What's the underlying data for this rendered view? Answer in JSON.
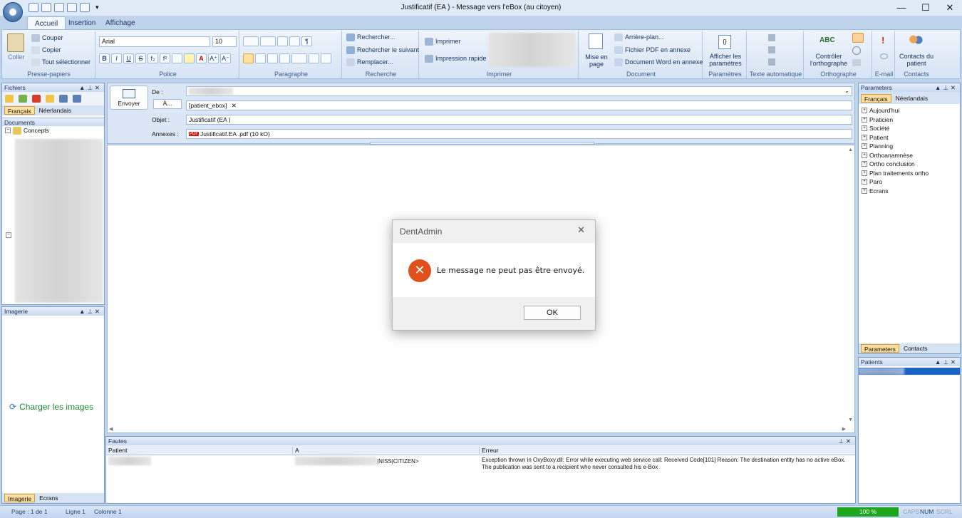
{
  "window": {
    "title": "Justificatif (EA ) - Message vers l'eBox (au citoyen)",
    "min": "—",
    "max": "☐",
    "close": "✕"
  },
  "tabs": [
    "Accueil",
    "Insertion",
    "Affichage"
  ],
  "ribbon": {
    "clipboard": {
      "paste": "Coller",
      "cut": "Couper",
      "copy": "Copier",
      "select_all": "Tout sélectionner",
      "label": "Presse-papiers"
    },
    "font": {
      "family": "Arial",
      "size": "10",
      "label": "Police",
      "bold": "B",
      "italic": "I",
      "underline": "U",
      "strike": "S",
      "sub": "f₂",
      "sup": "f²",
      "grow": "A⁺",
      "shrink": "A⁻",
      "color": "A"
    },
    "paragraph": {
      "label": "Paragraphe",
      "pilcrow": "¶"
    },
    "search": {
      "find": "Rechercher...",
      "find_next": "Rechercher le suivant",
      "replace": "Remplacer...",
      "label": "Recherche"
    },
    "print": {
      "print": "Imprimer",
      "quick_print": "Impression rapide",
      "label": "Imprimer"
    },
    "document": {
      "layout": "Mise en page",
      "background": "Arrière-plan...",
      "pdf": "Fichier PDF en annexe",
      "word": "Document Word en annexe",
      "label": "Document"
    },
    "params": {
      "show": "Afficher les paramètres",
      "label": "Paramètres"
    },
    "autotext": {
      "label": "Texte automatique"
    },
    "spelling": {
      "check": "Contrôler l'orthographe",
      "label": "Orthographe",
      "abc": "ABC"
    },
    "email": {
      "label": "E-mail",
      "excl": "!"
    },
    "contacts": {
      "button": "Contacts du patient",
      "label": "Contacts"
    }
  },
  "left": {
    "files_title": "Fichiers",
    "lang_fr": "Français",
    "lang_nl": "Néerlandais",
    "docs_header": "Documents",
    "root": "Concepts",
    "imagery_title": "Imagerie",
    "load_images": "Charger les images",
    "bottom_tabs": [
      "Imagerie",
      "Ecrans"
    ]
  },
  "compose": {
    "send": "Envoyer",
    "from_label": "De :",
    "to_button": "À...",
    "to_value": "[patient_ebox]",
    "to_remove": "✕",
    "subject_label": "Objet :",
    "subject_value": "Justificatif (EA )",
    "attach_label": "Annexes :",
    "attach_value": "Justificatif.EA .pdf (10 kO)",
    "pdf_badge": "PDF"
  },
  "faults": {
    "title": "Fautes",
    "columns": [
      "Patient",
      "A",
      "Erreur"
    ],
    "rows": [
      {
        "patient": "",
        "to": "|NISS|CITIZEN>",
        "error": "Exception thrown in OxyBoxy.dll: Error while executing web service call: Received Code[101] Reason:  The destination entity has no active eBox. The publication was sent to a recipient who never consulted his e-Box"
      }
    ]
  },
  "right": {
    "params_title": "Parameters",
    "lang_fr": "Français",
    "lang_nl": "Néerlandais",
    "items": [
      "Aujourd'hui",
      "Praticien",
      "Société",
      "Patient",
      "Planning",
      "Orthoanamnèse",
      "Ortho conclusion",
      "Plan traitements ortho",
      "Paro",
      "Ecrans"
    ],
    "tabs": [
      "Parameters",
      "Contacts"
    ],
    "patients_title": "Patients"
  },
  "dialog": {
    "title": "DentAdmin",
    "message": "Le message ne peut pas être envoyé.",
    "ok": "OK",
    "close": "✕"
  },
  "status": {
    "page": "Page : 1 de 1",
    "line": "Ligne 1",
    "column": "Colonne 1",
    "zoom": "100 %",
    "caps": "CAPS",
    "num": "NUM",
    "scrl": "SCRL"
  },
  "panel_ctrl": {
    "up": "▲",
    "pin": "⊥",
    "close": "✕"
  },
  "colors": {
    "accent": "#1b63c6",
    "error": "#e0501c",
    "zoom_bar": "#1ea61e",
    "load_link": "#1e8a2f"
  }
}
